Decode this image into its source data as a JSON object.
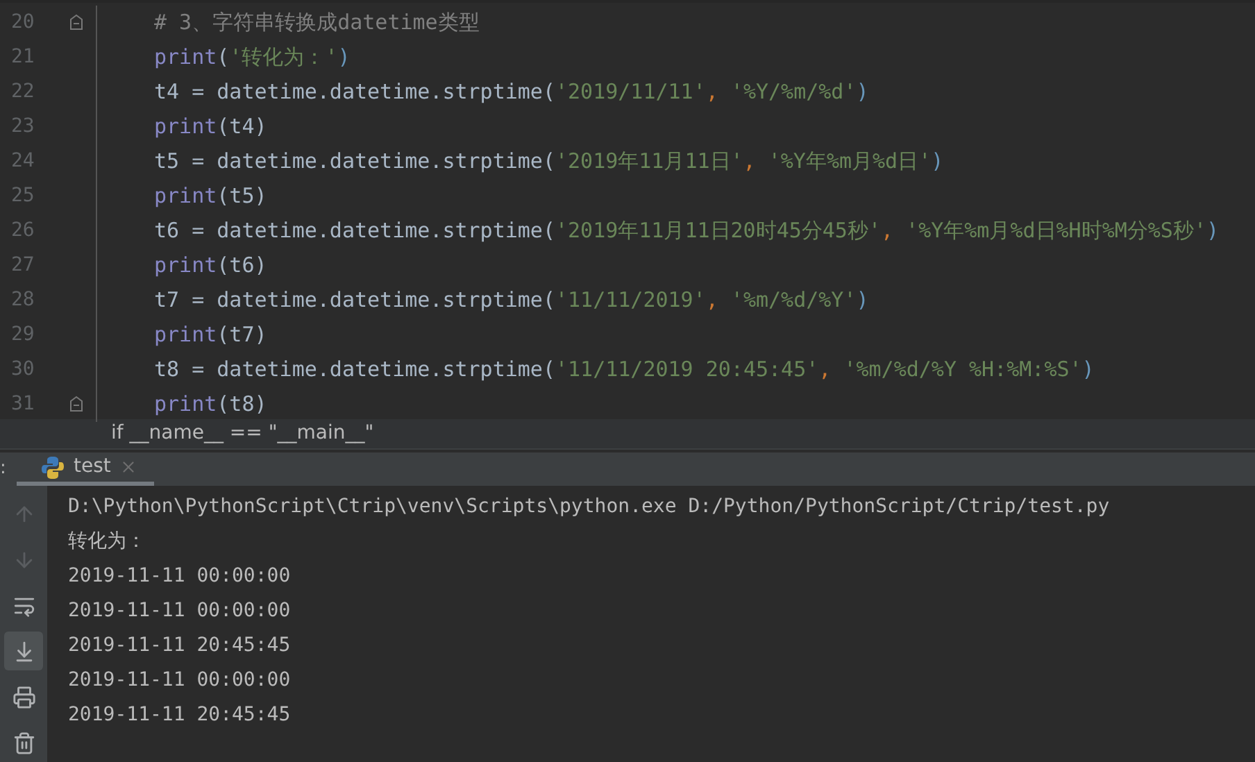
{
  "editor": {
    "lines": [
      {
        "number": "20",
        "fold": true,
        "tokens": [
          {
            "kind": "comment",
            "text": "# 3、字符串转换成datetime类型"
          }
        ]
      },
      {
        "number": "21",
        "fold": false,
        "tokens": [
          {
            "kind": "builtin",
            "text": "print"
          },
          {
            "kind": "plain",
            "text": "("
          },
          {
            "kind": "string",
            "text": "'转化为：'"
          },
          {
            "kind": "brace",
            "text": ")"
          }
        ]
      },
      {
        "number": "22",
        "fold": false,
        "tokens": [
          {
            "kind": "plain",
            "text": "t4 = datetime.datetime.strptime("
          },
          {
            "kind": "string",
            "text": "'2019/11/11'"
          },
          {
            "kind": "comma",
            "text": ", "
          },
          {
            "kind": "string",
            "text": "'%Y/%m/%d'"
          },
          {
            "kind": "brace",
            "text": ")"
          }
        ]
      },
      {
        "number": "23",
        "fold": false,
        "tokens": [
          {
            "kind": "builtin",
            "text": "print"
          },
          {
            "kind": "plain",
            "text": "(t4)"
          }
        ]
      },
      {
        "number": "24",
        "fold": false,
        "tokens": [
          {
            "kind": "plain",
            "text": "t5 = datetime.datetime.strptime("
          },
          {
            "kind": "string",
            "text": "'2019年11月11日'"
          },
          {
            "kind": "comma",
            "text": ", "
          },
          {
            "kind": "string",
            "text": "'%Y年%m月%d日'"
          },
          {
            "kind": "brace",
            "text": ")"
          }
        ]
      },
      {
        "number": "25",
        "fold": false,
        "tokens": [
          {
            "kind": "builtin",
            "text": "print"
          },
          {
            "kind": "plain",
            "text": "(t5)"
          }
        ]
      },
      {
        "number": "26",
        "fold": false,
        "tokens": [
          {
            "kind": "plain",
            "text": "t6 = datetime.datetime.strptime("
          },
          {
            "kind": "string",
            "text": "'2019年11月11日20时45分45秒'"
          },
          {
            "kind": "comma",
            "text": ", "
          },
          {
            "kind": "string",
            "text": "'%Y年%m月%d日%H时%M分%S秒'"
          },
          {
            "kind": "brace",
            "text": ")"
          }
        ]
      },
      {
        "number": "27",
        "fold": false,
        "tokens": [
          {
            "kind": "builtin",
            "text": "print"
          },
          {
            "kind": "plain",
            "text": "(t6)"
          }
        ]
      },
      {
        "number": "28",
        "fold": false,
        "tokens": [
          {
            "kind": "plain",
            "text": "t7 = datetime.datetime.strptime("
          },
          {
            "kind": "string",
            "text": "'11/11/2019'"
          },
          {
            "kind": "comma",
            "text": ", "
          },
          {
            "kind": "string",
            "text": "'%m/%d/%Y'"
          },
          {
            "kind": "brace",
            "text": ")"
          }
        ]
      },
      {
        "number": "29",
        "fold": false,
        "tokens": [
          {
            "kind": "builtin",
            "text": "print"
          },
          {
            "kind": "plain",
            "text": "(t7)"
          }
        ]
      },
      {
        "number": "30",
        "fold": false,
        "tokens": [
          {
            "kind": "plain",
            "text": "t8 = datetime.datetime.strptime("
          },
          {
            "kind": "string",
            "text": "'11/11/2019 20:45:45'"
          },
          {
            "kind": "comma",
            "text": ", "
          },
          {
            "kind": "string",
            "text": "'%m/%d/%Y %H:%M:%S'"
          },
          {
            "kind": "brace",
            "text": ")"
          }
        ]
      },
      {
        "number": "31",
        "fold": true,
        "tokens": [
          {
            "kind": "builtin",
            "text": "print"
          },
          {
            "kind": "plain",
            "text": "(t8)"
          }
        ]
      }
    ]
  },
  "breadcrumb": "if __name__ == \"__main__\"",
  "run_panel": {
    "label": ":",
    "tabs": [
      {
        "label": "test",
        "selected": true
      }
    ],
    "toolbar": [
      {
        "kind": "up",
        "selected": false
      },
      {
        "kind": "down",
        "selected": false
      },
      {
        "kind": "wrap",
        "selected": false
      },
      {
        "kind": "scroll-end",
        "selected": true
      },
      {
        "kind": "print",
        "selected": false
      },
      {
        "kind": "trash",
        "selected": false
      }
    ],
    "output": [
      "D:\\Python\\PythonScript\\Ctrip\\venv\\Scripts\\python.exe D:/Python/PythonScript/Ctrip/test.py",
      "转化为：",
      "2019-11-11 00:00:00",
      "2019-11-11 00:00:00",
      "2019-11-11 20:45:45",
      "2019-11-11 00:00:00",
      "2019-11-11 20:45:45"
    ]
  }
}
